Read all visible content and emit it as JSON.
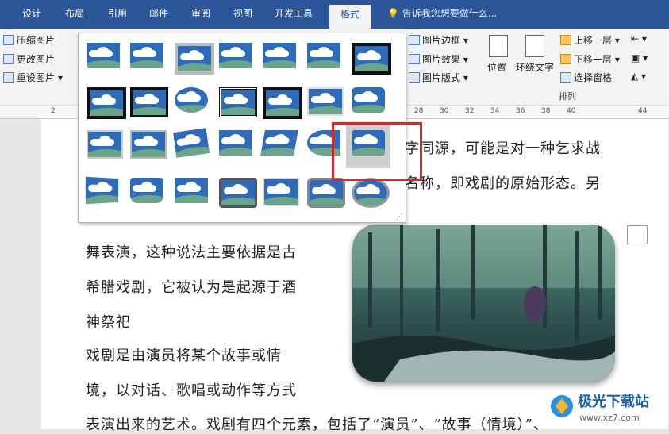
{
  "tabs": [
    "设计",
    "布局",
    "引用",
    "邮件",
    "审阅",
    "视图",
    "开发工具",
    "格式"
  ],
  "active_tab": "格式",
  "tell_me": "告诉我您想要做什么...",
  "ribbon": {
    "left": [
      "压缩图片",
      "更改图片",
      "重设图片"
    ],
    "styles": [
      "图片边框",
      "图片效果",
      "图片版式"
    ],
    "position": "位置",
    "wrap": "环绕文字",
    "arrange": [
      "上移一层",
      "下移一层",
      "选择窗格"
    ],
    "arrange_label": "排列"
  },
  "ruler_numbers": [
    "2",
    "28",
    "30",
    "32",
    "34",
    "36",
    "38",
    "40",
    "44"
  ],
  "document": {
    "line1": "字同源，可能是对一种乞求战",
    "line2": "名称，即戏剧的原始形态。另",
    "line3": "舞表演，这种说法主要依据是古",
    "line4": "希腊戏剧，它被认为是起源于酒",
    "line5": "神祭祀",
    "line6": "戏剧是由演员将某个故事或情",
    "line7": "境，以对话、歌唱或动作等方式",
    "line8": "表演出来的艺术。戏剧有四个元素，包括了“演员”、“故事（情境）”、"
  },
  "watermark": {
    "name": "极光下载站",
    "url": "www.xz7.com"
  },
  "colors": {
    "accent": "#2b579a",
    "highlight": "#d62828"
  }
}
